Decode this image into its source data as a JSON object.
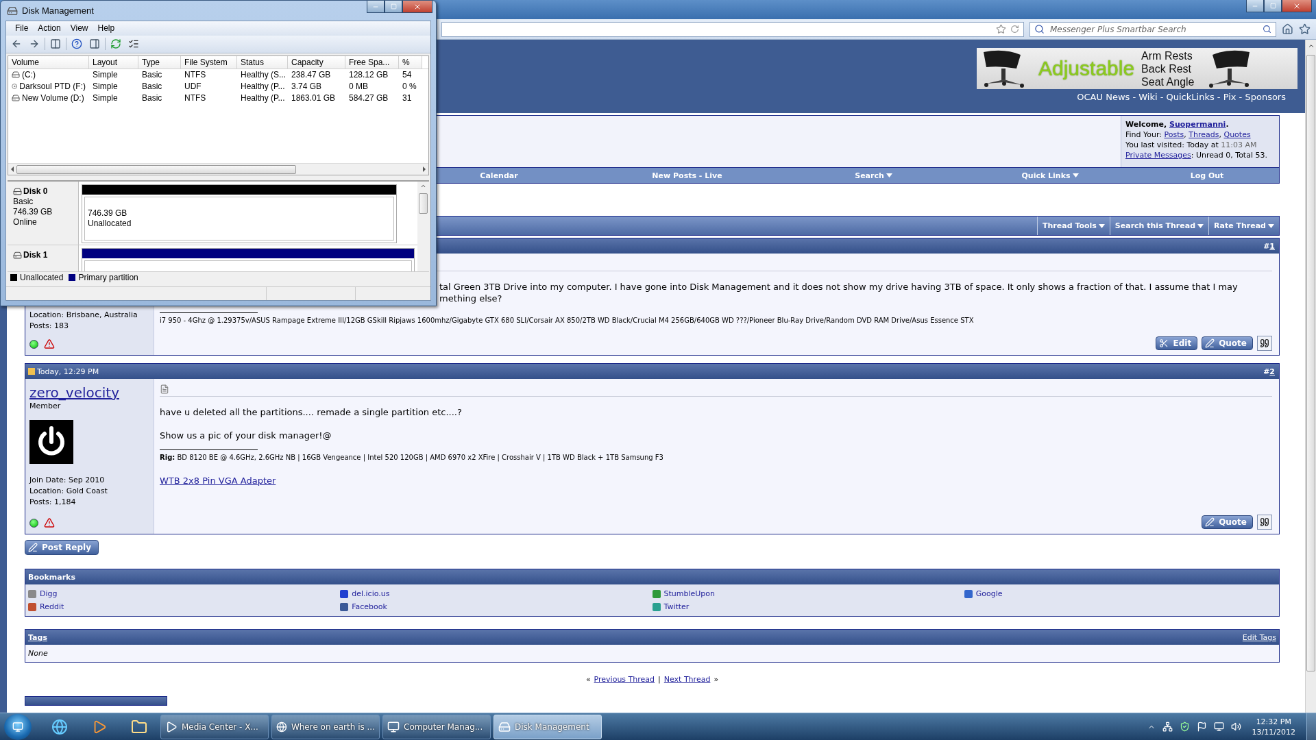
{
  "disk_management": {
    "title": "Disk Management",
    "menu": [
      "File",
      "Action",
      "View",
      "Help"
    ],
    "columns": [
      "Volume",
      "Layout",
      "Type",
      "File System",
      "Status",
      "Capacity",
      "Free Spa...",
      "%"
    ],
    "volumes": [
      {
        "kind": "disk",
        "cells": [
          "(C:)",
          "Simple",
          "Basic",
          "NTFS",
          "Healthy (S...",
          "238.47 GB",
          "128.12 GB",
          "54"
        ]
      },
      {
        "kind": "optical",
        "cells": [
          "Darksoul PTD (F:)",
          "Simple",
          "Basic",
          "UDF",
          "Healthy (P...",
          "3.74 GB",
          "0 MB",
          "0 %"
        ]
      },
      {
        "kind": "disk",
        "cells": [
          "New Volume (D:)",
          "Simple",
          "Basic",
          "NTFS",
          "Healthy (P...",
          "1863.01 GB",
          "584.27 GB",
          "31"
        ]
      }
    ],
    "disks": [
      {
        "name": "Disk 0",
        "details": [
          "Basic",
          "746.39 GB",
          "Online"
        ],
        "partitions": [
          {
            "kind": "unallocated",
            "lines": [
              "746.39 GB",
              "Unallocated"
            ]
          }
        ]
      },
      {
        "name": "Disk 1",
        "partitions": [
          {
            "kind": "primary"
          }
        ]
      }
    ],
    "legend": [
      {
        "label": "Unallocated",
        "color": "#000000"
      },
      {
        "label": "Primary partition",
        "color": "#000080"
      }
    ]
  },
  "browser": {
    "search": {
      "placeholder": "Messenger Plus Smartbar Search"
    }
  },
  "forum": {
    "banner": {
      "headline": "Adjustable",
      "lines": [
        "Arm Rests",
        "Back Rest",
        "Seat Angle"
      ]
    },
    "top_links": "OCAU News - Wiki - QuickLinks - Pix - Sponsors",
    "welcome": {
      "label": "Welcome,",
      "user": "Suopermanni",
      "end": ".",
      "find_label": "Find Your:",
      "find_links": [
        {
          "text": "Posts",
          "after": ","
        },
        {
          "text": "Threads",
          "after": ","
        },
        {
          "text": "Quotes"
        }
      ],
      "visited": "You last visited: Today at",
      "time": "11:03 AM",
      "pm_link": "Private Messages",
      "pm_text": ": Unread 0, Total 53."
    },
    "nav": [
      {
        "label": "Calendar",
        "menu": false
      },
      {
        "label": "New Posts - Live",
        "menu": false
      },
      {
        "label": "Search",
        "menu": true
      },
      {
        "label": "Quick Links",
        "menu": true
      },
      {
        "label": "Log Out",
        "menu": false
      }
    ],
    "thread_tools": [
      "Thread Tools",
      "Search this Thread",
      "Rate Thread"
    ],
    "posts": [
      {
        "mark": "#",
        "number": "1",
        "icon": false,
        "avatar": false,
        "user_info": [
          "Location: Brisbane, Australia",
          "Posts: 183"
        ],
        "online": true,
        "message": [
          "tal Green 3TB Drive into my computer. I have gone into Disk Management and it does not show my drive having 3TB of space. It only shows a fraction of that. I assume that I may",
          "mething else?"
        ],
        "signature": "i7 950 - 4Ghz @ 1.29375v/ASUS Rampage Extreme III/12GB GSkill Ripjaws 1600mhz/Gigabyte GTX 680 SLI/Corsair AX 850/2TB WD Black/Crucial M4 256GB/640GB WD ???/Pioneer Blu-Ray Drive/Random DVD RAM Drive/Asus Essence STX",
        "buttons": [
          {
            "kind": "edit",
            "label": "Edit"
          },
          {
            "kind": "quote",
            "label": "Quote"
          },
          {
            "kind": "multiquote"
          }
        ]
      },
      {
        "date": "Today, 12:29 PM",
        "mark": "#",
        "number": "2",
        "icon": true,
        "username": "zero_velocity",
        "user_title": "Member",
        "avatar": true,
        "user_info": [
          "Join Date: Sep 2010",
          "Location: Gold Coast",
          "Posts: 1,184"
        ],
        "online": true,
        "message": [
          "have u deleted all the partitions.... remade a single partition etc....?",
          "Show us a pic of your disk manager!@"
        ],
        "signature": "**Rig:** BD 8120 BE @ 4.6GHz, 2.6GHz NB | 16GB Vengeance | Intel 520 120GB | AMD 6970 x2 XFire | Crosshair V | 1TB WD Black + 1TB Samsung F3",
        "link": "WTB 2x8 Pin VGA Adapter",
        "buttons": [
          {
            "kind": "quote",
            "label": "Quote"
          },
          {
            "kind": "multiquote"
          }
        ]
      }
    ],
    "post_reply": "Post Reply",
    "bookmarks": {
      "title": "Bookmarks",
      "items": [
        {
          "label": "Digg",
          "color": "#8a8a8a"
        },
        {
          "label": "del.icio.us",
          "color": "#1f3fd0"
        },
        {
          "label": "StumbleUpon",
          "color": "#2e9a3a"
        },
        {
          "label": "Google",
          "color": "#3366cc"
        },
        {
          "label": "Reddit",
          "color": "#c05030"
        },
        {
          "label": "Facebook",
          "color": "#3b5998"
        },
        {
          "label": "Twitter",
          "color": "#2aa090"
        }
      ]
    },
    "tags": {
      "title": "Tags",
      "edit": "Edit Tags",
      "value": "None"
    },
    "thread_nav": {
      "open": "«",
      "prev": "Previous Thread",
      "sep": "|",
      "next": "Next Thread",
      "close": "»"
    }
  },
  "taskbar": {
    "tasks": [
      {
        "label": "Media Center - X...",
        "kind": "media",
        "selected": false
      },
      {
        "label": "Where on earth is ...",
        "kind": "browser",
        "selected": false
      },
      {
        "label": "Computer Manag...",
        "kind": "computer",
        "selected": false
      },
      {
        "label": "Disk Management",
        "kind": "disk",
        "selected": true
      }
    ],
    "time": "12:32 PM",
    "date": "13/11/2012"
  }
}
